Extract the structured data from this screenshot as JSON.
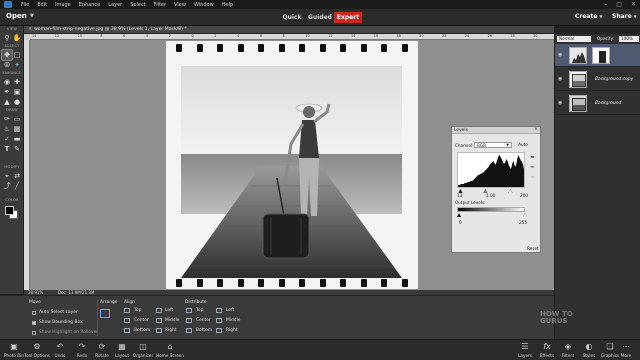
{
  "app": {
    "menus": [
      "File",
      "Edit",
      "Image",
      "Enhance",
      "Layer",
      "Select",
      "Filter",
      "View",
      "Window",
      "Help"
    ]
  },
  "topbar": {
    "open_label": "Open",
    "mode_tabs": [
      {
        "label": "Quick",
        "active": false
      },
      {
        "label": "Guided",
        "active": false
      },
      {
        "label": "Expert",
        "active": true
      }
    ],
    "create_label": "Create",
    "share_label": "Share"
  },
  "toolbox": {
    "sections": [
      "VIEW",
      "SELECT",
      "ENHANCE",
      "DRAW",
      "MODIFY",
      "COLOR"
    ],
    "foreground_color": "#000000",
    "background_color": "#ffffff"
  },
  "document": {
    "tab_title": "woman-film-strip-negative.jpg @ 38.9% (Levels 1, Layer Mask/8) *",
    "zoom": "38.91%",
    "doc_size": "Doc: 13.9M/21.3M",
    "ruler_marks": [
      "14",
      "12",
      "10",
      "8",
      "6",
      "4",
      "2",
      "0",
      "2",
      "4",
      "6",
      "8",
      "10",
      "12",
      "14",
      "16",
      "18",
      "20",
      "22",
      "24",
      "26",
      "28",
      "30"
    ]
  },
  "layers": {
    "blend_mode": "Normal",
    "opacity_label": "Opacity:",
    "opacity_value": "100%",
    "items": [
      {
        "name": "",
        "active": true,
        "has_mask": true
      },
      {
        "name": "Background copy",
        "active": false,
        "has_mask": false
      },
      {
        "name": "Background",
        "active": false,
        "has_mask": false
      }
    ]
  },
  "levels": {
    "title": "Levels",
    "channel_label": "Channel:",
    "channel_value": "RGB",
    "auto_label": "Auto",
    "input_black": "13",
    "input_gamma": "1.00",
    "input_white": "200",
    "output_label": "Output Levels:",
    "output_black": "0",
    "output_white": "255",
    "reset_label": "Reset",
    "histogram_series": [
      2,
      2,
      2,
      3,
      3,
      3,
      3,
      4,
      4,
      4,
      5,
      5,
      5,
      6,
      6,
      6,
      7,
      8,
      9,
      10,
      11,
      12,
      12,
      13,
      13,
      14,
      14,
      15,
      16,
      17,
      18,
      19,
      20,
      22,
      23,
      24,
      25,
      26,
      24,
      22,
      24,
      27,
      30,
      32,
      31,
      29,
      27,
      25,
      23,
      24,
      26,
      28,
      25,
      22,
      20,
      18,
      20,
      24,
      26,
      22,
      20,
      23,
      28,
      32,
      30,
      28,
      26,
      25,
      22,
      18
    ]
  },
  "tool_options": {
    "tool_name": "Move",
    "auto_select_layer": "Auto Select Layer",
    "show_bounding_box": "Show Bounding Box",
    "show_highlight": "Show Highlight on Rollover",
    "arrange_label": "Arrange",
    "align_label": "Align",
    "align_items": [
      "Top",
      "Center",
      "Bottom",
      "Left",
      "Middle",
      "Right"
    ],
    "distribute_label": "Distribute",
    "distribute_items": [
      "Top",
      "Center",
      "Bottom",
      "Left",
      "Middle",
      "Right"
    ]
  },
  "bottombar": {
    "left": [
      {
        "label": "Photo Bin",
        "icon": "photo-bin-icon"
      },
      {
        "label": "Tool Options",
        "icon": "tool-options-icon"
      },
      {
        "label": "Undo",
        "icon": "undo-icon"
      },
      {
        "label": "Redo",
        "icon": "redo-icon"
      },
      {
        "label": "Rotate",
        "icon": "rotate-icon"
      },
      {
        "label": "Layout",
        "icon": "layout-icon"
      },
      {
        "label": "Organizer",
        "icon": "organizer-icon"
      },
      {
        "label": "Home Screen",
        "icon": "home-screen-icon"
      }
    ],
    "right": [
      {
        "label": "Layers",
        "icon": "layers-icon"
      },
      {
        "label": "Effects",
        "icon": "effects-icon"
      },
      {
        "label": "Filters",
        "icon": "filters-icon"
      },
      {
        "label": "Styles",
        "icon": "styles-icon"
      },
      {
        "label": "Graphics",
        "icon": "graphics-icon"
      },
      {
        "label": "More",
        "icon": "more-icon"
      }
    ],
    "watermark": "HOW TO GURUS"
  }
}
